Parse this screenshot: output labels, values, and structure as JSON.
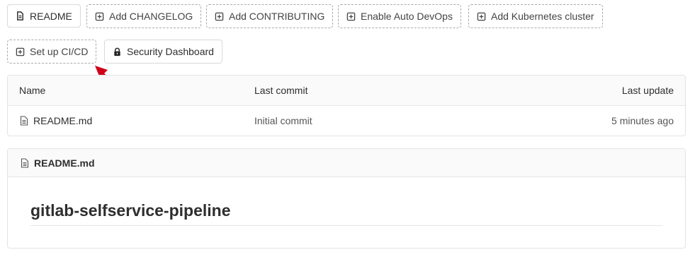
{
  "buttons": {
    "readme": "README",
    "add_changelog": "Add CHANGELOG",
    "add_contributing": "Add CONTRIBUTING",
    "enable_auto_devops": "Enable Auto DevOps",
    "add_kubernetes_cluster": "Add Kubernetes cluster",
    "set_up_cicd": "Set up CI/CD",
    "security_dashboard": "Security Dashboard"
  },
  "file_table": {
    "headers": {
      "name": "Name",
      "last_commit": "Last commit",
      "last_update": "Last update"
    },
    "rows": [
      {
        "name": "README.md",
        "last_commit": "Initial commit",
        "last_update": "5 minutes ago"
      }
    ]
  },
  "readme_panel": {
    "file_name": "README.md",
    "heading": "gitlab-selfservice-pipeline"
  },
  "colors": {
    "annotation_arrow": "#d0021b",
    "dashed_border": "#a9a9a9"
  },
  "icons": {
    "add": "plus-square-icon",
    "file": "file-text-icon",
    "lock": "lock-icon"
  }
}
